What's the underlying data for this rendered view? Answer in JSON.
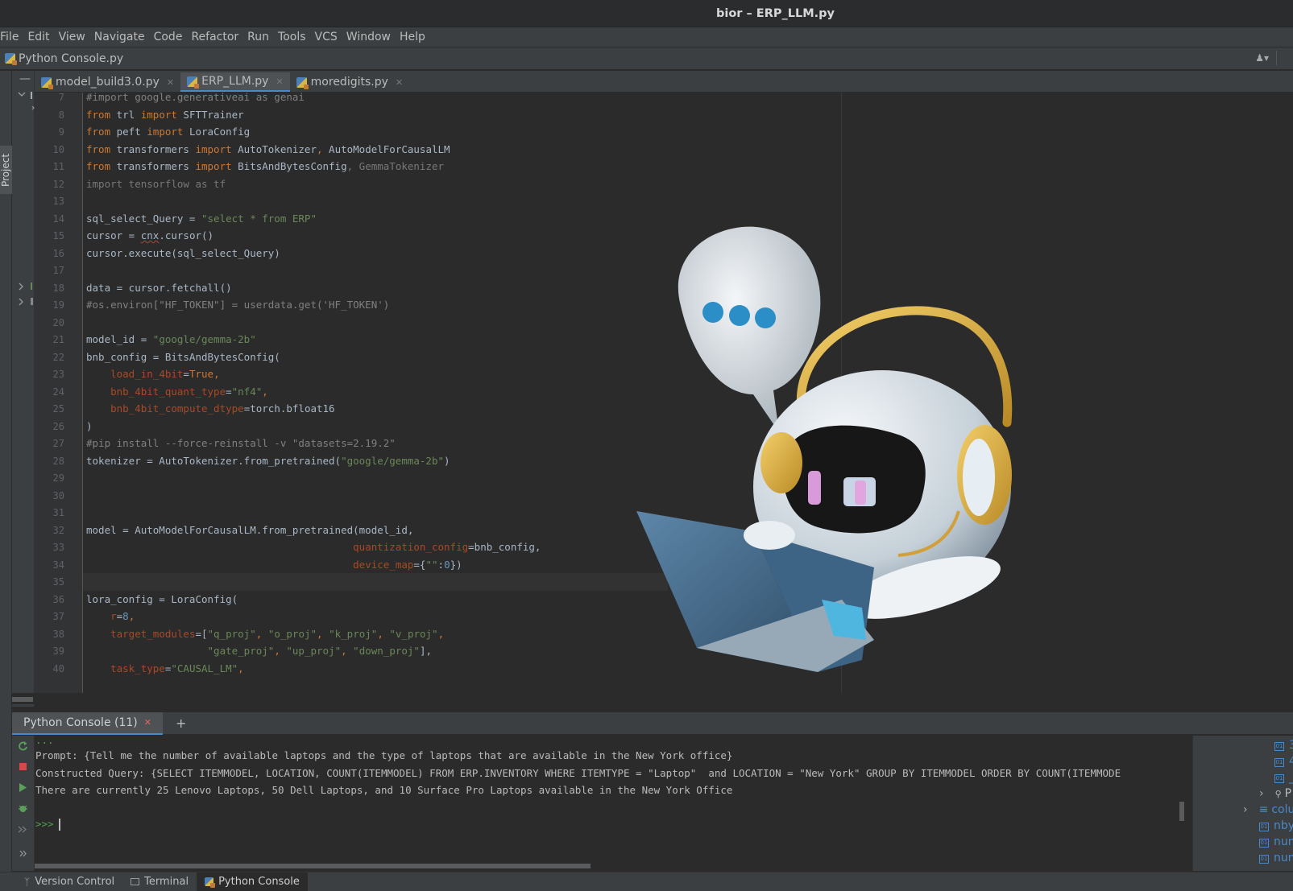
{
  "window": {
    "title": "bior – ERP_LLM.py"
  },
  "menu": [
    "File",
    "Edit",
    "View",
    "Navigate",
    "Code",
    "Refactor",
    "Run",
    "Tools",
    "VCS",
    "Window",
    "Help"
  ],
  "breadcrumb": {
    "file": "Python Console.py"
  },
  "left_panel": {
    "label": "Project"
  },
  "tabs": [
    {
      "label": "model_build3.0.py",
      "active": false
    },
    {
      "label": "ERP_LLM.py",
      "active": true
    },
    {
      "label": "moredigits.py",
      "active": false
    }
  ],
  "line_numbers": [
    "7",
    "8",
    "9",
    "10",
    "11",
    "12",
    "13",
    "14",
    "15",
    "16",
    "17",
    "18",
    "19",
    "20",
    "21",
    "22",
    "23",
    "24",
    "25",
    "26",
    "27",
    "28",
    "29",
    "30",
    "31",
    "32",
    "33",
    "34",
    "35",
    "36",
    "37",
    "38",
    "39",
    "40"
  ],
  "code": {
    "l7": "#import google.generativeai as genai",
    "l8_a": "from",
    "l8_b": " trl ",
    "l8_c": "import",
    "l8_d": " SFTTrainer",
    "l9_a": "from",
    "l9_b": " peft ",
    "l9_c": "import",
    "l9_d": " LoraConfig",
    "l10_a": "from",
    "l10_b": " transformers ",
    "l10_c": "import",
    "l10_d": " AutoTokenizer",
    "l10_e": ", ",
    "l10_f": "AutoModelForCausalLM",
    "l11_a": "from",
    "l11_b": " transformers ",
    "l11_c": "import",
    "l11_d": " BitsAndBytesConfig",
    "l11_e": ", GemmaTokenizer",
    "l12": "import tensorflow as tf",
    "l14_a": "sql_select_Query = ",
    "l14_b": "\"select * from ERP\"",
    "l15_a": "cursor = ",
    "l15_b": "cnx",
    "l15_c": ".cursor()",
    "l16": "cursor.execute(sql_select_Query)",
    "l18": "data = cursor.fetchall()",
    "l19": "#os.environ[\"HF_TOKEN\"] = userdata.get('HF_TOKEN')",
    "l21_a": "model_id = ",
    "l21_b": "\"google/gemma-2b\"",
    "l22": "bnb_config = BitsAndBytesConfig(",
    "l23_a": "load_in_4bit",
    "l23_b": "=",
    "l23_c": "True",
    "l23_d": ",",
    "l24_a": "bnb_4bit_quant_type",
    "l24_b": "=",
    "l24_c": "\"nf4\"",
    "l24_d": ",",
    "l25_a": "bnb_4bit_compute_dtype",
    "l25_b": "=torch.bfloat16",
    "l26": ")",
    "l27": "#pip install --force-reinstall -v \"datasets=2.19.2\"",
    "l28_a": "tokenizer = AutoTokenizer.from_pretrained(",
    "l28_b": "\"google/gemma-2b\"",
    "l28_c": ")",
    "l32": "model = AutoModelForCausalLM.from_pretrained(model_id,",
    "l33_a": "quantization_config",
    "l33_b": "=bnb_config,",
    "l34_a": "device_map",
    "l34_b": "={",
    "l34_c": "\"\"",
    "l34_d": ":",
    "l34_e": "0",
    "l34_f": "})",
    "l36": "lora_config = LoraConfig(",
    "l37_a": "r",
    "l37_b": "=",
    "l37_c": "8",
    "l37_d": ",",
    "l38_a": "target_modules",
    "l38_b": "=[",
    "l38_c": "\"q_proj\"",
    "l38_d": ", ",
    "l38_e": "\"o_proj\"",
    "l38_f": ", ",
    "l38_g": "\"k_proj\"",
    "l38_h": ", ",
    "l38_i": "\"v_proj\"",
    "l38_j": ",",
    "l39_a": "\"gate_proj\"",
    "l39_b": ", ",
    "l39_c": "\"up_proj\"",
    "l39_d": ", ",
    "l39_e": "\"down_proj\"",
    "l39_f": "],",
    "l40_a": "task_type",
    "l40_b": "=",
    "l40_c": "\"CAUSAL_LM\"",
    "l40_d": ","
  },
  "console": {
    "tab_label": "Python Console (11)",
    "add_label": "+",
    "dots": "...",
    "prompt_line": "Prompt: {Tell me the number of available laptops and the type of laptops that are available in the New York office}",
    "query_line": "Constructed Query: {SELECT ITEMMODEL, LOCATION, COUNT(ITEMMODEL) FROM ERP.INVENTORY WHERE ITEMTYPE = \"Laptop\"  and LOCATION = \"New York\" GROUP BY ITEMMODEL ORDER BY COUNT(ITEMMODE",
    "answer_line": "There are currently 25 Lenovo Laptops, 50 Dell Laptops, and 10 Surface Pro Laptops available in the New York Office",
    "input_prompt": ">>>"
  },
  "variables": [
    {
      "name": "3",
      "badge": "01"
    },
    {
      "name": "4",
      "badge": "01"
    },
    {
      "name": "_",
      "badge": "01"
    },
    {
      "name": "P",
      "badge": ""
    },
    {
      "name": "colu",
      "badge": ""
    },
    {
      "name": "nbyt",
      "badge": "01"
    },
    {
      "name": "num",
      "badge": "01"
    },
    {
      "name": "num",
      "badge": "01"
    }
  ],
  "statusbar": {
    "version_control": "Version Control",
    "terminal": "Terminal",
    "python_console": "Python Console"
  },
  "colors": {
    "keyword": "#cc7832",
    "string": "#6a8759",
    "comment": "#808080",
    "param": "#aa4926",
    "number": "#6897bb",
    "accent": "#4a88c7"
  },
  "icons": [
    "python-file-icon",
    "user-icon",
    "rerun-icon",
    "stop-icon",
    "run-icon",
    "debug-icon",
    "chevron-right-icon",
    "close-icon",
    "plus-icon",
    "terminal-icon",
    "vcs-icon",
    "robot-mascot-illustration"
  ]
}
